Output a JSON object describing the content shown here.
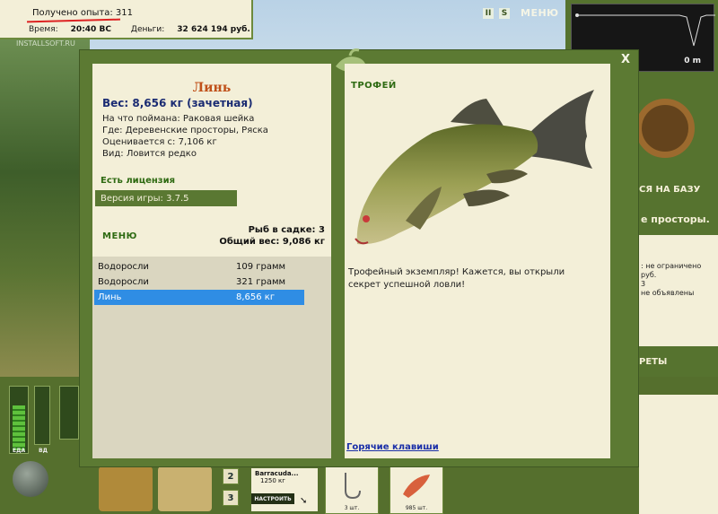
{
  "hud": {
    "xp": "Получено опыта: 311",
    "time_label": "Время:",
    "time_value": "20:40 ВС",
    "money_label": "Деньги:",
    "money_value": "32 624 194 руб.",
    "watermark": "INSTALLSOFT.RU",
    "menu_label": "МЕНЮ",
    "pause_label": "II",
    "sound_label": "S",
    "depth_value": "0 m"
  },
  "dialog": {
    "close_label": "X",
    "fish": {
      "name": "Линь",
      "weight": "Вес: 8,656 кг (зачетная)",
      "bait": "На что поймана: Раковая шейка",
      "location": "Где: Деревенские просторы, Ряска",
      "valued": "Оценивается с: 7,106 кг",
      "species": "Вид: Ловится редко"
    },
    "license": "Есть лицензия",
    "version": "Версия игры: 3.7.5",
    "menu_label": "МЕНЮ",
    "keepnet": {
      "count": "Рыб в садке: 3",
      "total": "Общий вес: 9,086 кг"
    },
    "catch_list": [
      {
        "name": "Водоросли",
        "weight": "109 грамм",
        "selected": false
      },
      {
        "name": "Водоросли",
        "weight": "321 грамм",
        "selected": false
      },
      {
        "name": "Линь",
        "weight": "8,656 кг",
        "selected": true
      }
    ],
    "trophy": {
      "header": "ТРОФЕЙ",
      "message": "Трофейный экземпляр! Кажется, вы открыли секрет успешной ловли!"
    },
    "hotkeys": "Горячие клавиши"
  },
  "background": {
    "base_text": "СЯ НА БАЗУ",
    "location_text": "е просторы.",
    "info_lines": [
      ": не ограничено",
      "руб.",
      "3",
      "не объявлены"
    ],
    "secrets_text": "РЕТЫ"
  },
  "bottom": {
    "food_label": "ЕДА",
    "drink_label": "ВД",
    "food_level": 0.72,
    "drink_level": 0.0,
    "slot2": "2",
    "slot3": "3",
    "bait_name": "Barracuda...",
    "bait_weight": "1250 кг",
    "setup_btn": "НАСТРОИТЬ",
    "hook_count": "3 шт.",
    "lure_count": "985 шт."
  },
  "colors": {
    "accent_green": "#5c7a33",
    "panel_cream": "#f3efd8",
    "selection_blue": "#2f8de4",
    "fish_name": "#c0511a"
  }
}
